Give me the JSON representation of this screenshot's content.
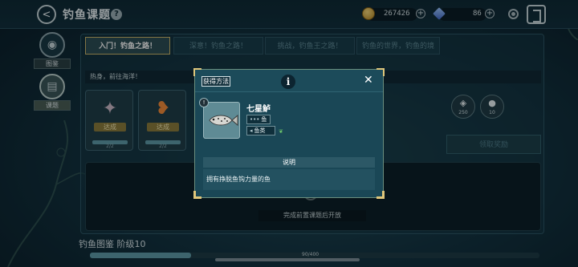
{
  "header": {
    "title": "钓鱼课题",
    "help_glyph": "?",
    "back_glyph": "<",
    "coins": "267426",
    "gems": "86",
    "plus_glyph": "+"
  },
  "nav": {
    "atlas_label": "图鉴",
    "topics_label": "课题"
  },
  "tabs": [
    {
      "label": "入门！钓鱼之路！",
      "active": true
    },
    {
      "label": "深意！钓鱼之路！",
      "active": false
    },
    {
      "label": "挑战，钓鱼王之路！",
      "active": false
    },
    {
      "label": "钓鱼的世界，钓鱼的境",
      "active": false
    }
  ],
  "banner_text": "热身，前往海洋！",
  "quests": [
    {
      "badge": "达成",
      "progress_text": "2/2",
      "progress": 1.0
    },
    {
      "badge": "达成",
      "progress_text": "2/2",
      "progress": 1.0
    }
  ],
  "rewards": [
    {
      "value": "250"
    },
    {
      "value": "10"
    }
  ],
  "claim_label": "领取奖励",
  "locked_text": "完成前置课题后开放",
  "atlas": {
    "label": "钓鱼图鉴  阶级10",
    "progress_text": "90/400",
    "progress": 0.225
  },
  "modal": {
    "title": "获得方法",
    "info_glyph": "i",
    "close_glyph": "✕",
    "fish_name": "七星鲈",
    "fish_number": "!",
    "tag1": "鱼",
    "tag2": "鱼类",
    "desc_header": "说明",
    "desc_text": "拥有挣脱鱼钩力量的鱼"
  },
  "colors": {
    "accent_gold": "#e0c77b",
    "progress_fill": "#5e9aa8",
    "done_badge": "#8a7b3c"
  }
}
